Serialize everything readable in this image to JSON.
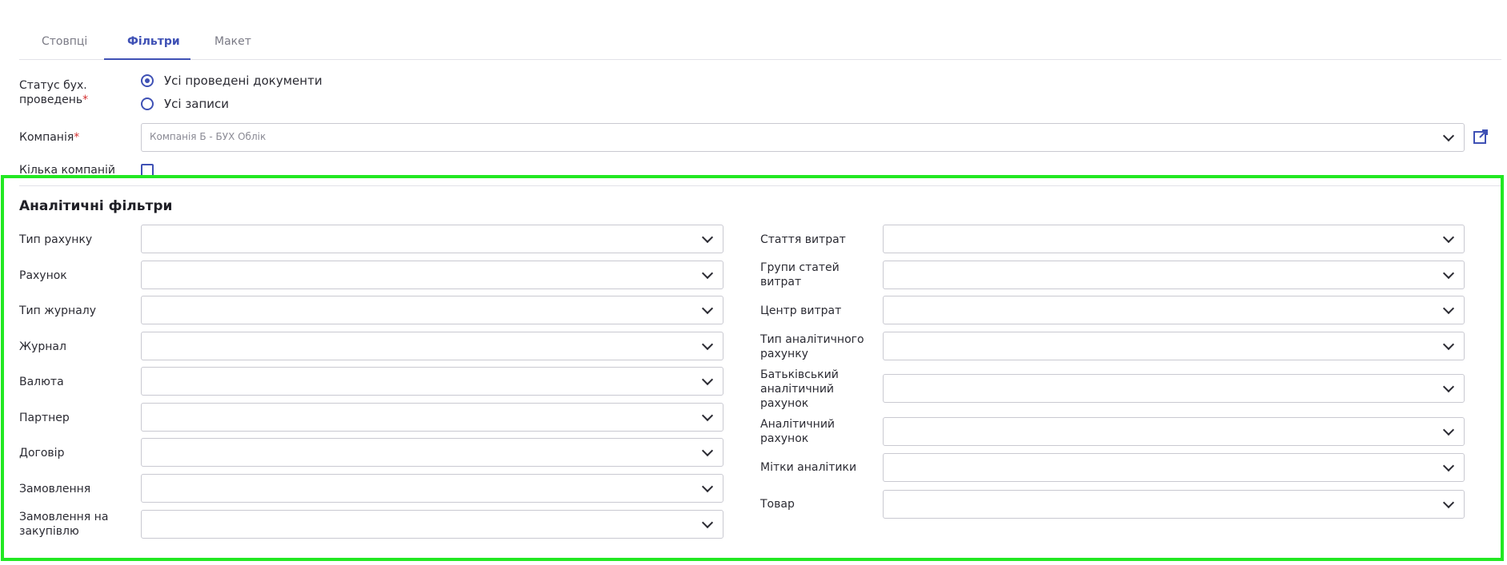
{
  "tabs": [
    "Стовпці",
    "Фільтри",
    "Макет"
  ],
  "posting_status": {
    "label_line1": "Статус бух.",
    "label_line2": "проведень",
    "required_mark": "*",
    "options": [
      "Усі проведені документи",
      "Усі записи"
    ],
    "selected_index": 0
  },
  "company": {
    "label": "Компанія",
    "required_mark": "*",
    "value": "Компанія Б - БУХ Облік"
  },
  "multi_company": {
    "label": "Кількa компаній",
    "checked": false
  },
  "analytics": {
    "title": "Аналітичні фільтри",
    "left_fields": [
      {
        "label": "Тип рахунку"
      },
      {
        "label": "Рахунок"
      },
      {
        "label": "Тип журналу"
      },
      {
        "label": "Журнал"
      },
      {
        "label": "Валюта"
      },
      {
        "label": "Партнер"
      },
      {
        "label": "Договір"
      },
      {
        "label": "Замовлення"
      },
      {
        "label_line1": "Замовлення на",
        "label_line2": "закупівлю"
      }
    ],
    "right_fields": [
      {
        "label": "Стаття витрат"
      },
      {
        "label_line1": "Групи статей",
        "label_line2": "витрат"
      },
      {
        "label": "Центр витрат"
      },
      {
        "label_line1": "Тип аналітичного",
        "label_line2": "рахунку"
      },
      {
        "label_line1": "Батьківський",
        "label_line2": "аналітичний",
        "label_line3": "рахунок"
      },
      {
        "label_line1": "Аналітичний",
        "label_line2": "рахунок"
      },
      {
        "label": "Мітки аналітики"
      },
      {
        "label": "Товар"
      }
    ]
  },
  "colors": {
    "accent": "#3f51b5",
    "required": "#d32f2f",
    "highlight": "#22e822"
  }
}
